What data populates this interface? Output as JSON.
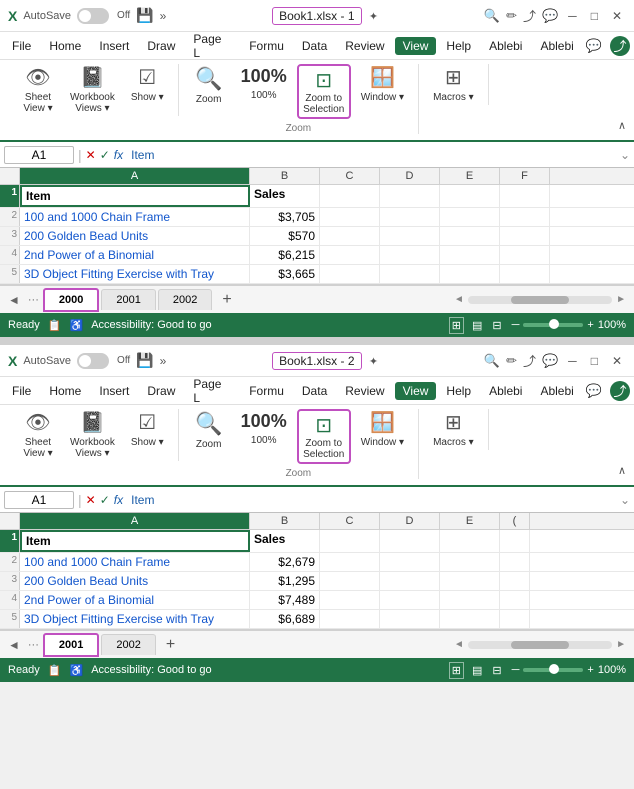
{
  "window1": {
    "titlebar": {
      "logo": "X",
      "autosave": "AutoSave",
      "toggle": "Off",
      "title": "Book1.xlsx - 1",
      "star_icon": "✦"
    },
    "menu": {
      "items": [
        "File",
        "Home",
        "Insert",
        "Draw",
        "Page L",
        "Formu",
        "Data",
        "Review",
        "View",
        "Help",
        "Ablebi",
        "Ablebi"
      ]
    },
    "ribbon": {
      "groups": [
        {
          "label": "",
          "items": [
            {
              "icon": "👁",
              "label": "Sheet\nView"
            },
            {
              "icon": "📋",
              "label": "Workbook\nViews"
            },
            {
              "icon": "📊",
              "label": "Show"
            }
          ]
        },
        {
          "label": "Zoom",
          "items": [
            {
              "icon": "🔍",
              "label": "Zoom"
            },
            {
              "icon": "💯",
              "label": "100%"
            },
            {
              "icon": "⬛",
              "label": "Zoom to\nSelection"
            },
            {
              "icon": "🪟",
              "label": "Window"
            }
          ]
        },
        {
          "label": "",
          "items": [
            {
              "icon": "⊞",
              "label": "Macros"
            }
          ]
        }
      ]
    },
    "formula_bar": {
      "cell_ref": "A1",
      "formula_text": "Item"
    },
    "columns": [
      "A",
      "B",
      "C",
      "D",
      "E",
      "F"
    ],
    "rows": [
      {
        "num": "1",
        "item": "Item",
        "sales": "Sales",
        "header": true
      },
      {
        "num": "2",
        "item": "100 and 1000 Chain Frame",
        "sales": "$3,705"
      },
      {
        "num": "3",
        "item": "200 Golden Bead Units",
        "sales": "$570"
      },
      {
        "num": "4",
        "item": "2nd Power of a Binomial",
        "sales": "$6,215"
      },
      {
        "num": "5",
        "item": "3D Object Fitting Exercise with Tray",
        "sales": "$3,665"
      }
    ],
    "tabs": {
      "prev_btn": "◄",
      "ellipsis": "...",
      "active": "2000",
      "others": [
        "2001",
        "2002"
      ],
      "add": "+"
    },
    "status": {
      "text": "Ready",
      "accessibility": "Accessibility: Good to go",
      "zoom": "100%"
    }
  },
  "window2": {
    "titlebar": {
      "logo": "X",
      "autosave": "AutoSave",
      "toggle": "Off",
      "title": "Book1.xlsx - 2",
      "star_icon": "✦"
    },
    "menu": {
      "items": [
        "File",
        "Home",
        "Insert",
        "Draw",
        "Page L",
        "Formu",
        "Data",
        "Review",
        "View",
        "Help",
        "Ablebi",
        "Ablebi"
      ]
    },
    "ribbon": {
      "groups": [
        {
          "label": "",
          "items": [
            {
              "icon": "👁",
              "label": "Sheet\nView"
            },
            {
              "icon": "📋",
              "label": "Workbook\nViews"
            },
            {
              "icon": "📊",
              "label": "Show"
            }
          ]
        },
        {
          "label": "Zoom",
          "items": [
            {
              "icon": "🔍",
              "label": "Zoom"
            },
            {
              "icon": "💯",
              "label": "100%"
            },
            {
              "icon": "⬛",
              "label": "Zoom to\nSelection"
            },
            {
              "icon": "🪟",
              "label": "Window"
            }
          ]
        },
        {
          "label": "",
          "items": [
            {
              "icon": "⊞",
              "label": "Macros"
            }
          ]
        }
      ]
    },
    "formula_bar": {
      "cell_ref": "A1",
      "formula_text": "Item"
    },
    "columns": [
      "A",
      "B",
      "C",
      "D",
      "E",
      "F"
    ],
    "rows": [
      {
        "num": "1",
        "item": "Item",
        "sales": "Sales",
        "header": true
      },
      {
        "num": "2",
        "item": "100 and 1000 Chain Frame",
        "sales": "$2,679"
      },
      {
        "num": "3",
        "item": "200 Golden Bead Units",
        "sales": "$1,295"
      },
      {
        "num": "4",
        "item": "2nd Power of a Binomial",
        "sales": "$7,489"
      },
      {
        "num": "5",
        "item": "3D Object Fitting Exercise with Tray",
        "sales": "$6,689"
      }
    ],
    "tabs": {
      "prev_btn": "◄",
      "ellipsis": "...",
      "active": "2001",
      "others": [
        "2002"
      ],
      "add": "+"
    },
    "status": {
      "text": "Ready",
      "accessibility": "Accessibility: Good to go",
      "zoom": "100%"
    }
  },
  "icons": {
    "autosave_icon": "💾",
    "search_icon": "🔍",
    "pen_icon": "✏",
    "share_icon": "↑",
    "chat_icon": "💬",
    "close_icon": "✕",
    "min_icon": "─",
    "max_icon": "□",
    "checkmark_icon": "✓",
    "cancel_icon": "✕",
    "fx_icon": "fx"
  }
}
